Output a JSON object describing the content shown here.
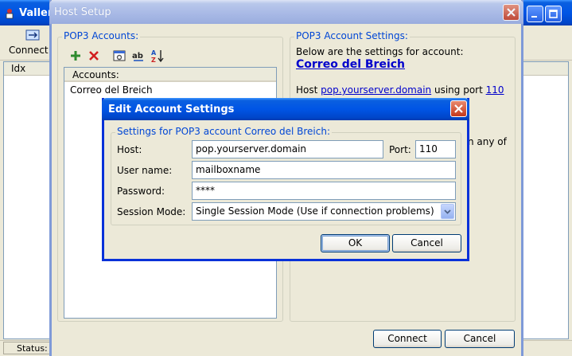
{
  "main_window": {
    "title": "Valler",
    "toolbar_connect_label": "Connect",
    "list_column_idx": "Idx",
    "status_text": "Status:"
  },
  "host_setup": {
    "title": "Host Setup",
    "pop3_accounts_legend": "POP3 Accounts:",
    "accounts_header": "Accounts:",
    "accounts": [
      "Correo del Breich"
    ],
    "settings_legend": "POP3 Account Settings:",
    "settings_intro": "Below are the settings for account:",
    "account_name": "Correo del Breich",
    "host_prefix": "Host ",
    "host_value": "pop.yourserver.domain",
    "using_port_text": " using port ",
    "port_value": "110",
    "partial_text": "n any of",
    "connect_button": "Connect",
    "cancel_button": "Cancel"
  },
  "edit_dialog": {
    "title": "Edit Account Settings",
    "group_legend": "Settings for POP3 account Correo del Breich:",
    "host_label": "Host:",
    "host_value": "pop.yourserver.domain",
    "port_label": "Port:",
    "port_value": "110",
    "username_label": "User name:",
    "username_value": "mailboxname",
    "password_label": "Password:",
    "password_value": "****",
    "session_mode_label": "Session Mode:",
    "session_mode_value": "Single Session Mode (Use if connection problems)",
    "ok_button": "OK",
    "cancel_button": "Cancel"
  },
  "colors": {
    "xp_title_blue": "#0055e5",
    "inactive_title": "#a7b8e5",
    "group_legend_blue": "#0046d5",
    "link_blue": "#0000cc",
    "window_bg": "#ece9d8"
  },
  "icons": {
    "add": "plus-icon",
    "delete": "red-x-icon",
    "properties": "properties-icon",
    "rename": "rename-icon",
    "sort": "sort-az-icon"
  }
}
